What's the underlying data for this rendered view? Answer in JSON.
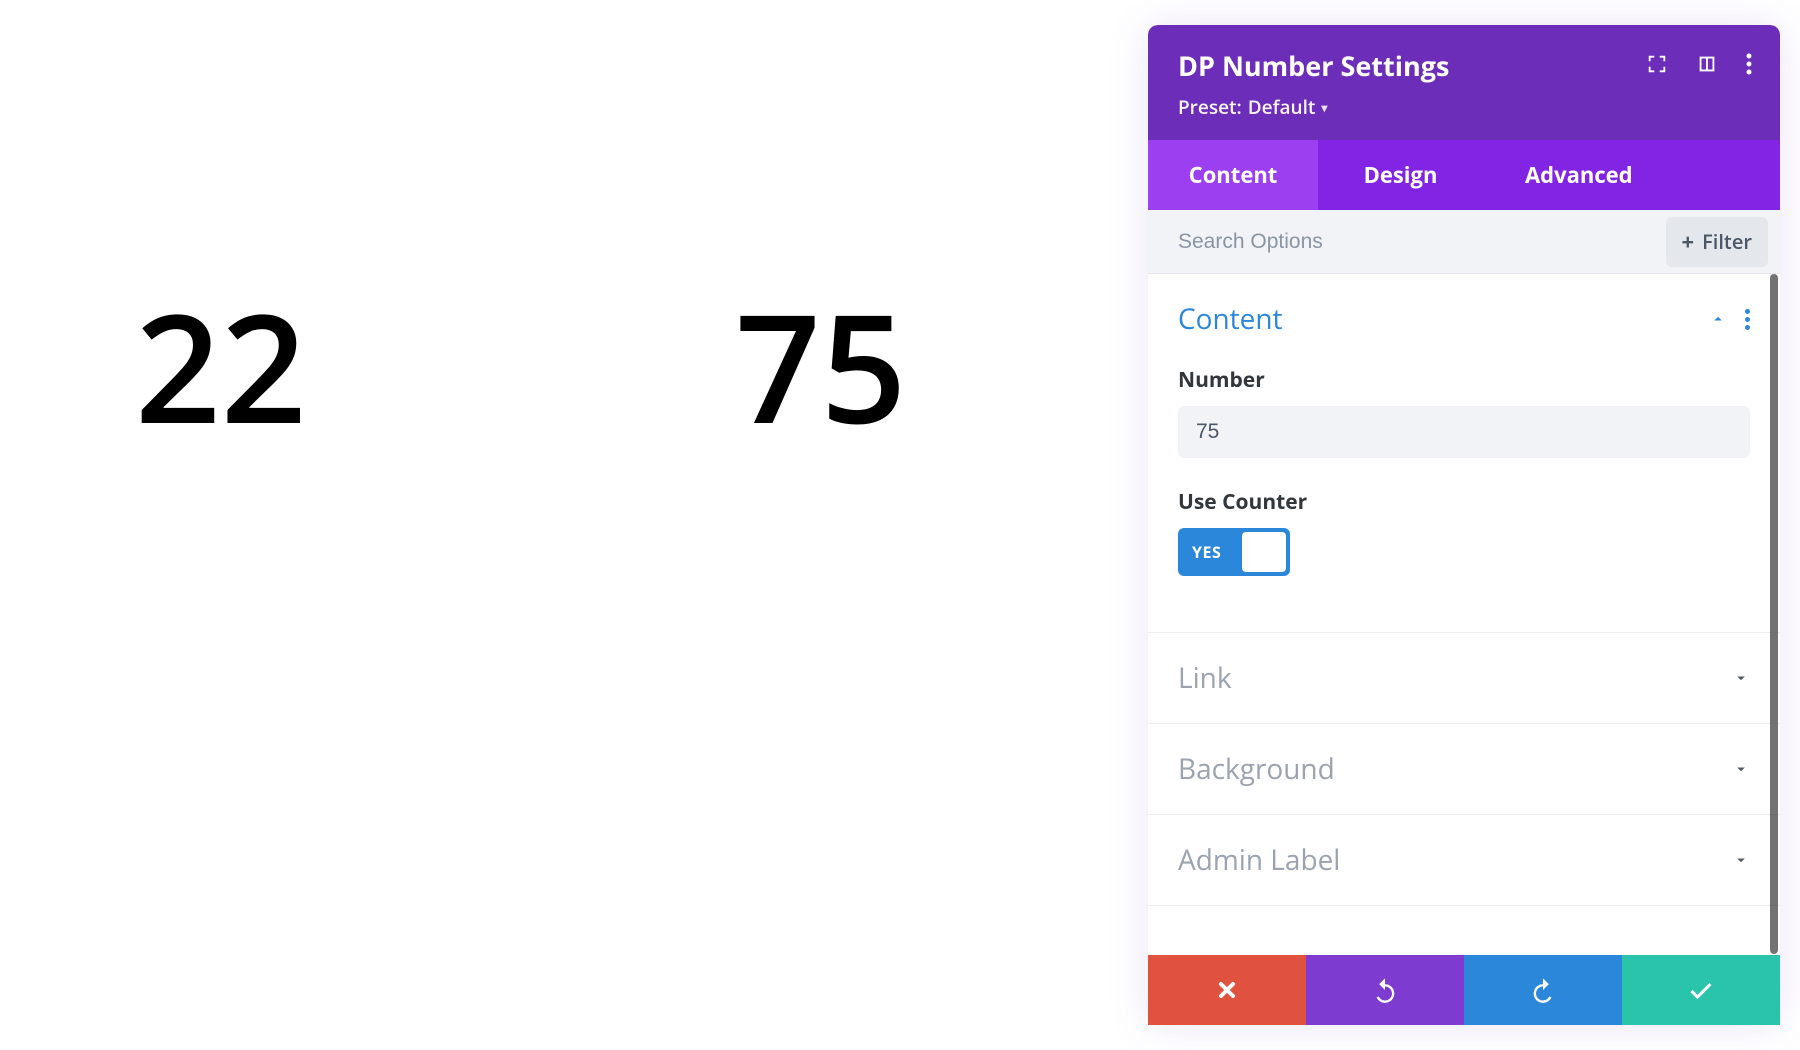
{
  "canvas": {
    "number_left": "22",
    "number_right": "75"
  },
  "panel": {
    "title": "DP Number Settings",
    "preset_prefix": "Preset:",
    "preset_value": "Default"
  },
  "tabs": {
    "content": "Content",
    "design": "Design",
    "advanced": "Advanced"
  },
  "search": {
    "placeholder": "Search Options",
    "filter_label": "Filter"
  },
  "sections": {
    "content": {
      "title": "Content",
      "number_label": "Number",
      "number_value": "75",
      "use_counter_label": "Use Counter",
      "toggle_value": "YES"
    },
    "link": {
      "title": "Link"
    },
    "background": {
      "title": "Background"
    },
    "admin_label": {
      "title": "Admin Label"
    }
  },
  "colors": {
    "header_purple": "#6c2eb9",
    "tab_purple": "#8224e3",
    "tab_active": "#9b3ff0",
    "blue": "#2b87da",
    "red": "#e0523f",
    "teal": "#29c4a9"
  }
}
